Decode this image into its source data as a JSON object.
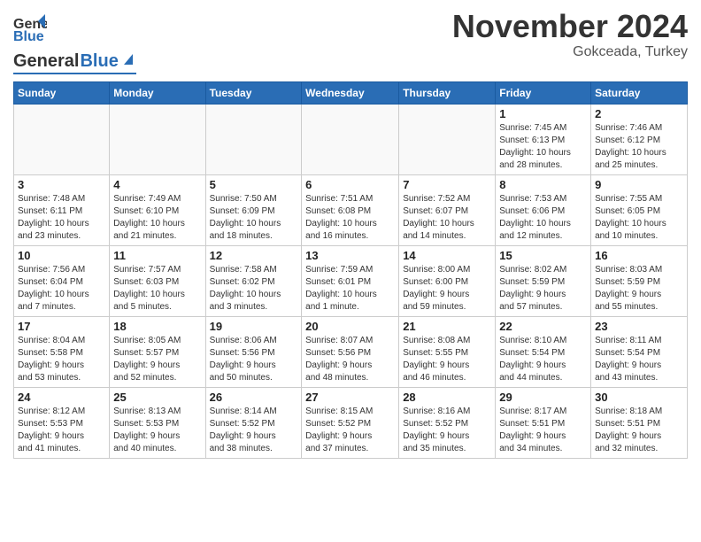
{
  "header": {
    "logo_line1": "General",
    "logo_line2": "Blue",
    "month": "November 2024",
    "location": "Gokceada, Turkey"
  },
  "weekdays": [
    "Sunday",
    "Monday",
    "Tuesday",
    "Wednesday",
    "Thursday",
    "Friday",
    "Saturday"
  ],
  "weeks": [
    [
      {
        "day": "",
        "info": ""
      },
      {
        "day": "",
        "info": ""
      },
      {
        "day": "",
        "info": ""
      },
      {
        "day": "",
        "info": ""
      },
      {
        "day": "",
        "info": ""
      },
      {
        "day": "1",
        "info": "Sunrise: 7:45 AM\nSunset: 6:13 PM\nDaylight: 10 hours\nand 28 minutes."
      },
      {
        "day": "2",
        "info": "Sunrise: 7:46 AM\nSunset: 6:12 PM\nDaylight: 10 hours\nand 25 minutes."
      }
    ],
    [
      {
        "day": "3",
        "info": "Sunrise: 7:48 AM\nSunset: 6:11 PM\nDaylight: 10 hours\nand 23 minutes."
      },
      {
        "day": "4",
        "info": "Sunrise: 7:49 AM\nSunset: 6:10 PM\nDaylight: 10 hours\nand 21 minutes."
      },
      {
        "day": "5",
        "info": "Sunrise: 7:50 AM\nSunset: 6:09 PM\nDaylight: 10 hours\nand 18 minutes."
      },
      {
        "day": "6",
        "info": "Sunrise: 7:51 AM\nSunset: 6:08 PM\nDaylight: 10 hours\nand 16 minutes."
      },
      {
        "day": "7",
        "info": "Sunrise: 7:52 AM\nSunset: 6:07 PM\nDaylight: 10 hours\nand 14 minutes."
      },
      {
        "day": "8",
        "info": "Sunrise: 7:53 AM\nSunset: 6:06 PM\nDaylight: 10 hours\nand 12 minutes."
      },
      {
        "day": "9",
        "info": "Sunrise: 7:55 AM\nSunset: 6:05 PM\nDaylight: 10 hours\nand 10 minutes."
      }
    ],
    [
      {
        "day": "10",
        "info": "Sunrise: 7:56 AM\nSunset: 6:04 PM\nDaylight: 10 hours\nand 7 minutes."
      },
      {
        "day": "11",
        "info": "Sunrise: 7:57 AM\nSunset: 6:03 PM\nDaylight: 10 hours\nand 5 minutes."
      },
      {
        "day": "12",
        "info": "Sunrise: 7:58 AM\nSunset: 6:02 PM\nDaylight: 10 hours\nand 3 minutes."
      },
      {
        "day": "13",
        "info": "Sunrise: 7:59 AM\nSunset: 6:01 PM\nDaylight: 10 hours\nand 1 minute."
      },
      {
        "day": "14",
        "info": "Sunrise: 8:00 AM\nSunset: 6:00 PM\nDaylight: 9 hours\nand 59 minutes."
      },
      {
        "day": "15",
        "info": "Sunrise: 8:02 AM\nSunset: 5:59 PM\nDaylight: 9 hours\nand 57 minutes."
      },
      {
        "day": "16",
        "info": "Sunrise: 8:03 AM\nSunset: 5:59 PM\nDaylight: 9 hours\nand 55 minutes."
      }
    ],
    [
      {
        "day": "17",
        "info": "Sunrise: 8:04 AM\nSunset: 5:58 PM\nDaylight: 9 hours\nand 53 minutes."
      },
      {
        "day": "18",
        "info": "Sunrise: 8:05 AM\nSunset: 5:57 PM\nDaylight: 9 hours\nand 52 minutes."
      },
      {
        "day": "19",
        "info": "Sunrise: 8:06 AM\nSunset: 5:56 PM\nDaylight: 9 hours\nand 50 minutes."
      },
      {
        "day": "20",
        "info": "Sunrise: 8:07 AM\nSunset: 5:56 PM\nDaylight: 9 hours\nand 48 minutes."
      },
      {
        "day": "21",
        "info": "Sunrise: 8:08 AM\nSunset: 5:55 PM\nDaylight: 9 hours\nand 46 minutes."
      },
      {
        "day": "22",
        "info": "Sunrise: 8:10 AM\nSunset: 5:54 PM\nDaylight: 9 hours\nand 44 minutes."
      },
      {
        "day": "23",
        "info": "Sunrise: 8:11 AM\nSunset: 5:54 PM\nDaylight: 9 hours\nand 43 minutes."
      }
    ],
    [
      {
        "day": "24",
        "info": "Sunrise: 8:12 AM\nSunset: 5:53 PM\nDaylight: 9 hours\nand 41 minutes."
      },
      {
        "day": "25",
        "info": "Sunrise: 8:13 AM\nSunset: 5:53 PM\nDaylight: 9 hours\nand 40 minutes."
      },
      {
        "day": "26",
        "info": "Sunrise: 8:14 AM\nSunset: 5:52 PM\nDaylight: 9 hours\nand 38 minutes."
      },
      {
        "day": "27",
        "info": "Sunrise: 8:15 AM\nSunset: 5:52 PM\nDaylight: 9 hours\nand 37 minutes."
      },
      {
        "day": "28",
        "info": "Sunrise: 8:16 AM\nSunset: 5:52 PM\nDaylight: 9 hours\nand 35 minutes."
      },
      {
        "day": "29",
        "info": "Sunrise: 8:17 AM\nSunset: 5:51 PM\nDaylight: 9 hours\nand 34 minutes."
      },
      {
        "day": "30",
        "info": "Sunrise: 8:18 AM\nSunset: 5:51 PM\nDaylight: 9 hours\nand 32 minutes."
      }
    ]
  ]
}
